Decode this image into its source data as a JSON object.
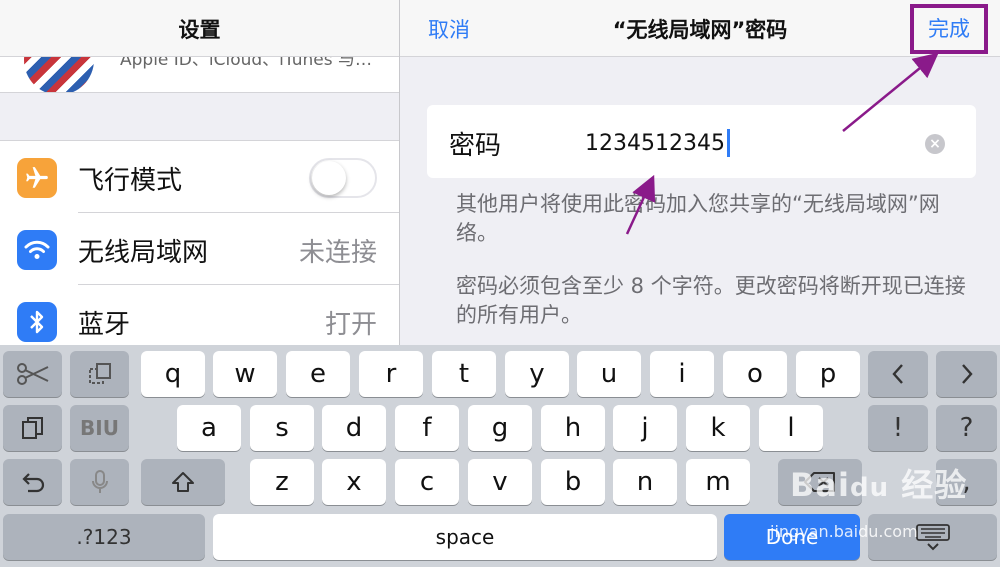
{
  "left_pane": {
    "title": "设置",
    "profile_subtitle": "Apple ID、iCloud、iTunes 与…",
    "rows": [
      {
        "label": "飞行模式",
        "icon": "airplane-icon",
        "icon_color": "#f7a33a",
        "toggle": "off"
      },
      {
        "label": "无线局域网",
        "value": "未连接",
        "icon": "wifi-icon",
        "icon_color": "#2f7cf6"
      },
      {
        "label": "蓝牙",
        "value": "打开",
        "icon": "bluetooth-icon",
        "icon_color": "#2f7cf6"
      }
    ]
  },
  "right_pane": {
    "cancel_label": "取消",
    "title": "“无线局域网”密码",
    "done_label": "完成",
    "password_label": "密码",
    "password_value": "1234512345",
    "footnote_1": "其他用户将使用此密码加入您共享的“无线局域网”网络。",
    "footnote_2": "密码必须包含至少 8 个字符。更改密码将断开现已连接的所有用户。"
  },
  "keyboard": {
    "row1": [
      "q",
      "w",
      "e",
      "r",
      "t",
      "y",
      "u",
      "i",
      "o",
      "p"
    ],
    "row2": [
      "a",
      "s",
      "d",
      "f",
      "g",
      "h",
      "j",
      "k",
      "l"
    ],
    "row3": [
      "z",
      "x",
      "c",
      "v",
      "b",
      "n",
      "m"
    ],
    "symbols_label": ".?123",
    "space_label": "space",
    "done_label": "Done",
    "exclaim": "!",
    "question": "?",
    "comma": ",",
    "format_label": "BIU"
  },
  "watermark": {
    "text": "Bai经验",
    "url": "jingyan.baidu.com"
  },
  "colors": {
    "accent": "#2f7cf6",
    "annotation": "#8a1a8a"
  }
}
